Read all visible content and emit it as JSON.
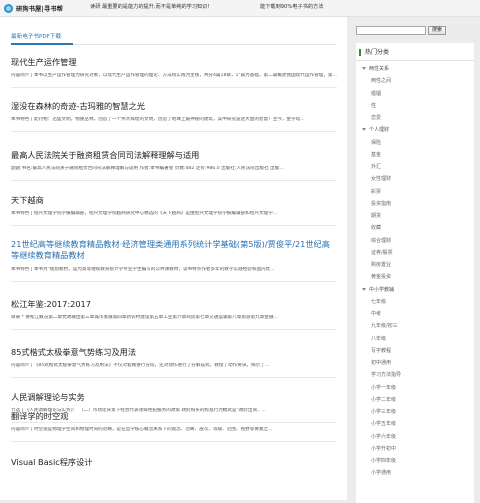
{
  "header": {
    "site_name": "研狗书屋|寻书帮",
    "tip_left": "读研 最重要的是能力的提升,而不是单纯的学习知识!",
    "tip_right": "能下载到90%电子书的方法"
  },
  "main": {
    "section_label": "最新电子书PDF下载",
    "articles": [
      {
        "title": "现代生产运作管理",
        "summary": "内容简介 | 本书以生产运作管理为研究对象，以现代生产运作管理的理论、方法和实践为主线，共分4篇18章，1\"篇为基础，第二篇概述我国现代运作管理，第..."
      },
      {
        "title": "湿没在森林的奇迹-古玛雅的智慧之光",
        "summary": "本书特色 | 此刊物：迅猛文明，物质丛林，创造了一个伟大辉煌的文明，创造了地球上最神秘的建筑，其中研究遗迹大胆的智慧！至今，金字塔..."
      },
      {
        "title": "最高人民法院关于融资租赁合同司法解释理解与适用",
        "summary": "副题:书名:最高人民法院关于融资租赁合同司法解释理解与适用 作者:本书编著会 页数:482 定价:¥86.0 出版社:人民法院出版社 出版..."
      },
      {
        "title": "天下越商",
        "summary": "本书特色 | 绍兴文理学院学报编辑部，绍兴文理学院越商研究中心精选的《天下越商》是由绍兴文理学院学报编辑部和绍兴文理学..."
      },
      {
        "title": "21世纪高等继续教育精品教材·经济管理类通用系列统计学基础(第5版)/贾俊平/21世纪高等继续教育精品教材",
        "summary": "本书特色 | 本书为\"规划教材，是为高等继续教育统计学专业学生编写的公共课教材，读书特点作者多年的教学实践经验和国内优..."
      },
      {
        "title": "松江年鉴:2017:2017",
        "summary": "目录 * 要松江概况第二章党政联团第三章城市发展第四章新农村建设第五章工业第六章商贸第七章交通运输第八章旅游第九章金融..."
      },
      {
        "title": "85式楷式太极拳意气势练习及用法",
        "summary": "内容简介 | 《85式楷式太极拳意气势练习及用法》不仅对套路进行分段，还对动作进行了分解成式，教授了动作要诀，揭示了..."
      },
      {
        "title": "人民调解理论与实务",
        "summary": "节选 | 《人民调解理论与实务》：    （二）市场化背景下经营代表领域经纪服务的政策    政府购买的标准行为模式是\"政府出资、..."
      },
      {
        "title": "翻译学的时空观",
        "summary": "内容简介 | 时空观是物理学空间和物理时间的范畴，是在哲学核心概念关系下的观念、范畴、层次、等级、范围、视野等要素之..."
      },
      {
        "title": "Visual Basic程序设计",
        "summary": ""
      }
    ]
  },
  "sidebar": {
    "search_placeholder": "",
    "search_button": "搜索",
    "categories_title": "热门分类",
    "categories": [
      {
        "label": "两性关系",
        "type": "group"
      },
      {
        "label": "两性之间",
        "type": "sub"
      },
      {
        "label": "婚姻",
        "type": "sub"
      },
      {
        "label": "性",
        "type": "sub"
      },
      {
        "label": "恋爱",
        "type": "sub"
      },
      {
        "label": "个人理财",
        "type": "group"
      },
      {
        "label": "保险",
        "type": "sub"
      },
      {
        "label": "基金",
        "type": "sub"
      },
      {
        "label": "外汇",
        "type": "sub"
      },
      {
        "label": "女性理财",
        "type": "sub"
      },
      {
        "label": "彩票",
        "type": "sub"
      },
      {
        "label": "投资指南",
        "type": "sub"
      },
      {
        "label": "期货",
        "type": "sub"
      },
      {
        "label": "收藏",
        "type": "sub"
      },
      {
        "label": "综合理财",
        "type": "sub"
      },
      {
        "label": "证券/股票",
        "type": "sub"
      },
      {
        "label": "购房置业",
        "type": "sub"
      },
      {
        "label": "黄金投资",
        "type": "sub"
      },
      {
        "label": "中小学教辅",
        "type": "group"
      },
      {
        "label": "七年级",
        "type": "sub"
      },
      {
        "label": "中考",
        "type": "sub"
      },
      {
        "label": "九年级/初三",
        "type": "sub"
      },
      {
        "label": "八年级",
        "type": "sub"
      },
      {
        "label": "写字教程",
        "type": "sub"
      },
      {
        "label": "初中通用",
        "type": "sub"
      },
      {
        "label": "学习方法指导",
        "type": "sub"
      },
      {
        "label": "小学一年级",
        "type": "sub"
      },
      {
        "label": "小学二年级",
        "type": "sub"
      },
      {
        "label": "小学三年级",
        "type": "sub"
      },
      {
        "label": "小学五年级",
        "type": "sub"
      },
      {
        "label": "小学六年级",
        "type": "sub"
      },
      {
        "label": "小学升初中",
        "type": "sub"
      },
      {
        "label": "小学四年级",
        "type": "sub"
      },
      {
        "label": "小学通用",
        "type": "sub"
      }
    ]
  }
}
